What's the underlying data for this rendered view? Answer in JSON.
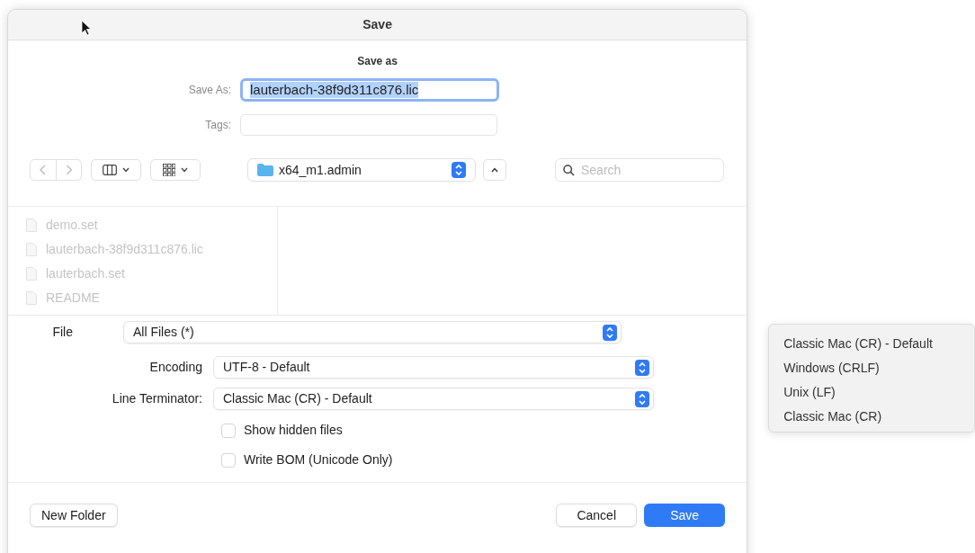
{
  "window": {
    "title": "Save"
  },
  "header": "Save as",
  "save_as": {
    "label": "Save As:",
    "value": "lauterbach-38f9d311c876.lic"
  },
  "tags": {
    "label": "Tags:"
  },
  "toolbar": {
    "location": "x64_m1.admin",
    "search": {
      "placeholder": "Search"
    }
  },
  "files": [
    {
      "name": "demo.set",
      "disabled": true
    },
    {
      "name": "lauterbach-38f9d311c876.lic",
      "disabled": true
    },
    {
      "name": "lauterbach.set",
      "disabled": true
    },
    {
      "name": "README",
      "disabled": true
    }
  ],
  "options": [
    {
      "label": "File",
      "value": "All Files (*)"
    },
    {
      "label": "Encoding",
      "value": "UTF-8 - Default"
    },
    {
      "label": "Line Terminator:",
      "value": "Classic Mac (CR) - Default"
    }
  ],
  "checkboxes": [
    {
      "label": "Show hidden files",
      "checked": false
    },
    {
      "label": "Write BOM (Unicode Only)",
      "checked": false
    }
  ],
  "buttons": {
    "new_folder": "New Folder",
    "cancel": "Cancel",
    "save": "Save"
  },
  "menu": [
    "Classic Mac (CR) - Default",
    "Windows (CRLF)",
    "Unix (LF)",
    "Classic Mac (CR)"
  ]
}
